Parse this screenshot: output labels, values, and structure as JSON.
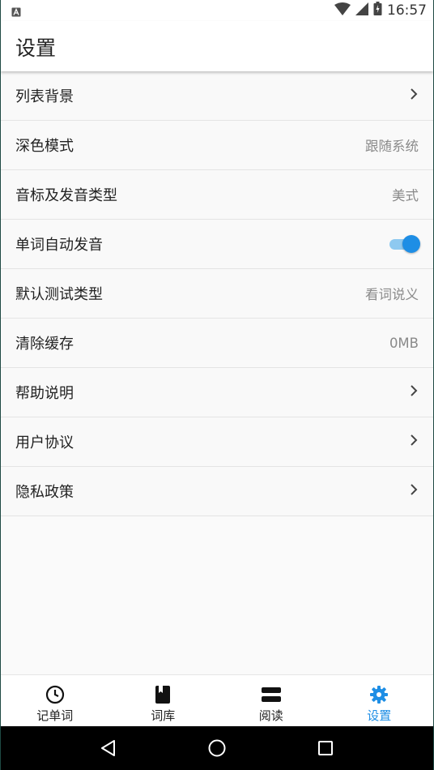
{
  "status_bar": {
    "time": "16:57",
    "notification_icon": "a-box-icon",
    "icons": [
      "wifi-icon",
      "signal-icon",
      "battery-icon"
    ]
  },
  "header": {
    "title": "设置"
  },
  "settings": {
    "items": [
      {
        "label": "列表背景",
        "value": "",
        "accessory": "chevron"
      },
      {
        "label": "深色模式",
        "value": "跟随系统",
        "accessory": "value"
      },
      {
        "label": "音标及发音类型",
        "value": "美式",
        "accessory": "value"
      },
      {
        "label": "单词自动发音",
        "value": "",
        "accessory": "toggle",
        "toggle_on": true
      },
      {
        "label": "默认测试类型",
        "value": "看词说义",
        "accessory": "value"
      },
      {
        "label": "清除缓存",
        "value": "0MB",
        "accessory": "value"
      },
      {
        "label": "帮助说明",
        "value": "",
        "accessory": "chevron"
      },
      {
        "label": "用户协议",
        "value": "",
        "accessory": "chevron"
      },
      {
        "label": "隐私政策",
        "value": "",
        "accessory": "chevron"
      }
    ]
  },
  "bottom_nav": {
    "items": [
      {
        "label": "记单词",
        "icon": "clock-icon",
        "active": false
      },
      {
        "label": "词库",
        "icon": "book-icon",
        "active": false
      },
      {
        "label": "阅读",
        "icon": "reading-icon",
        "active": false
      },
      {
        "label": "设置",
        "icon": "gear-icon",
        "active": true
      }
    ]
  },
  "colors": {
    "accent": "#1e8ee5",
    "toggle_track": "#8ec9f0",
    "secondary_text": "#8a8a8a"
  },
  "system_nav": {
    "buttons": [
      "back-icon",
      "home-icon",
      "recents-icon"
    ]
  }
}
